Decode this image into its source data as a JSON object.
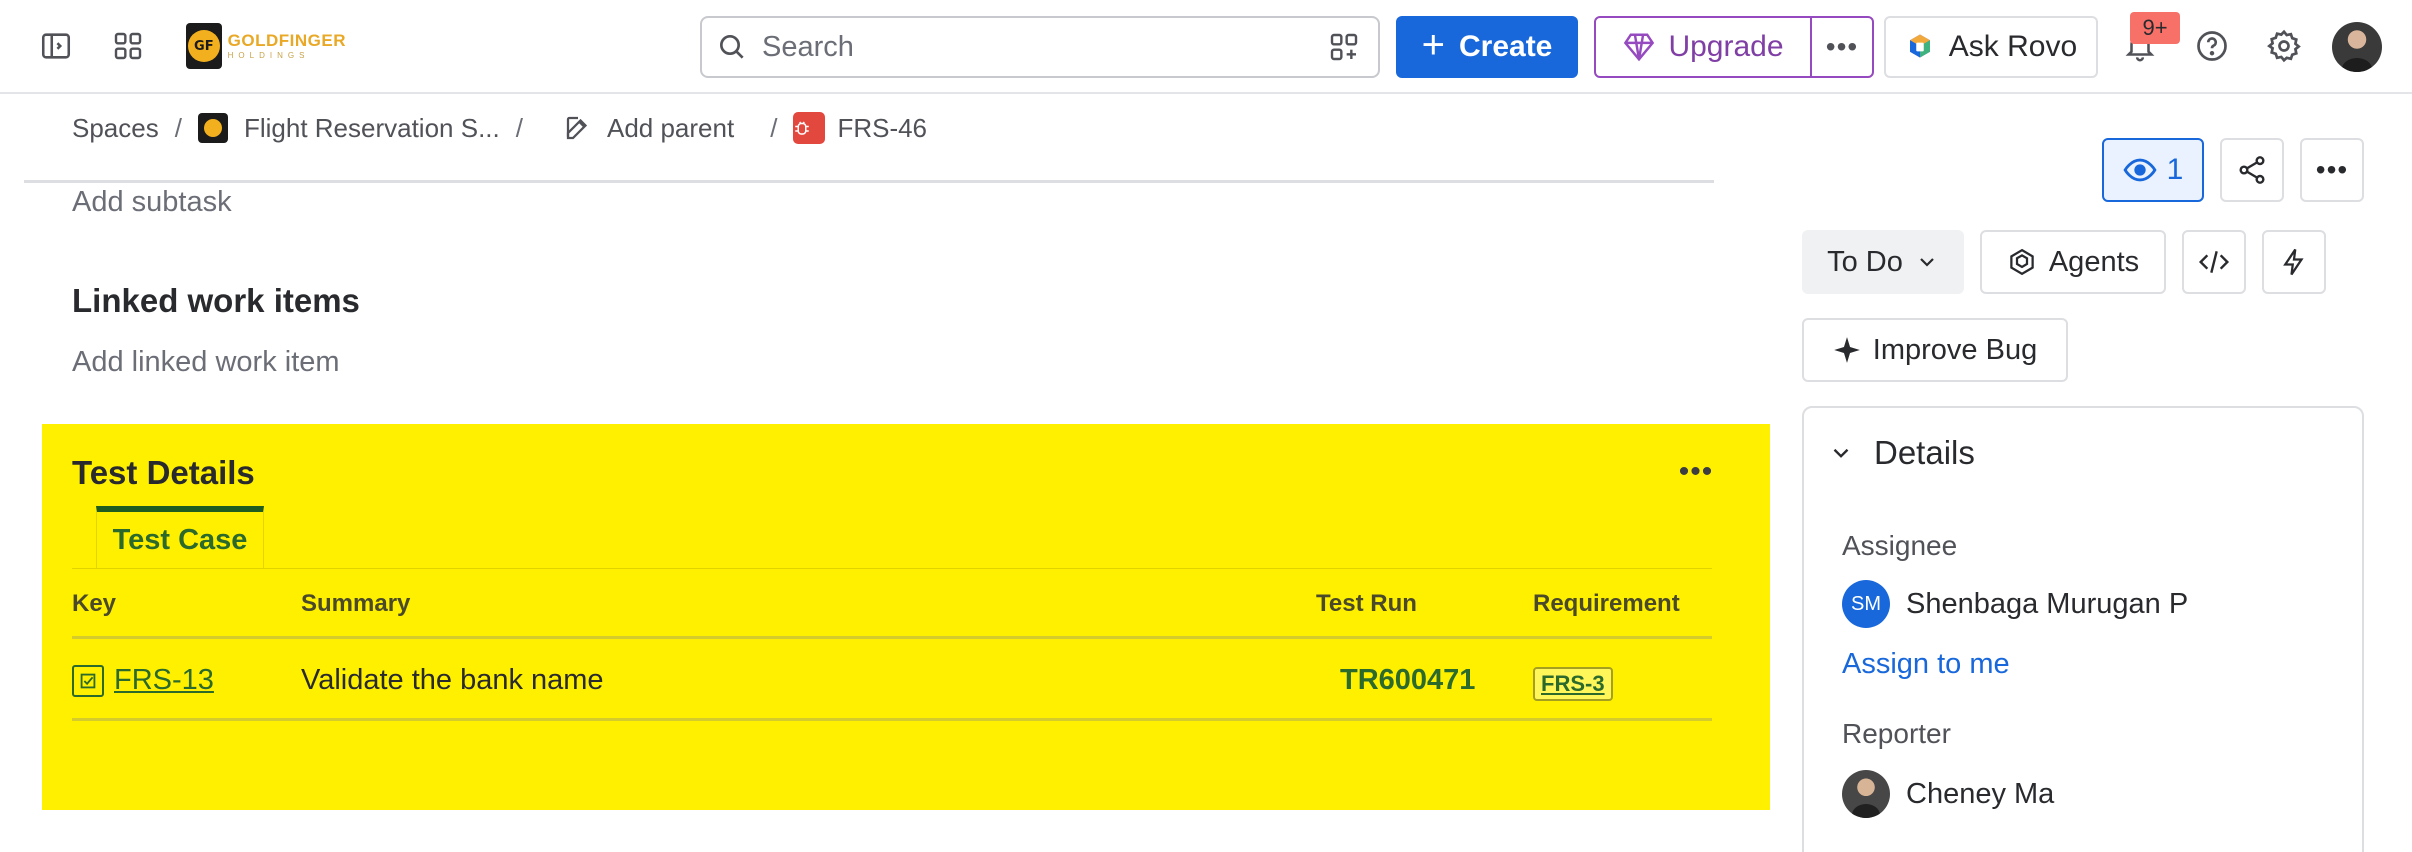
{
  "topnav": {
    "logo_line1": "GOLDFINGER",
    "logo_line2": "HOLDINGS",
    "logo_mark": "GF",
    "search_placeholder": "Search",
    "create_label": "Create",
    "upgrade_label": "Upgrade",
    "more_label": "•••",
    "ask_rovo_label": "Ask Rovo",
    "notification_count": "9+",
    "icons": [
      "sidebar-toggle-icon",
      "app-switcher-icon",
      "search-icon",
      "scan-add-icon",
      "gem-icon",
      "rovo-icon",
      "bell-icon",
      "help-icon",
      "gear-icon"
    ]
  },
  "breadcrumb": {
    "spaces": "Spaces",
    "project": "Flight Reservation S...",
    "add_parent": "Add parent",
    "issue_key": "FRS-46",
    "separator": "/"
  },
  "content": {
    "add_subtask": "Add subtask",
    "linked_title": "Linked work items",
    "add_linked": "Add linked work item"
  },
  "test_details": {
    "title": "Test Details",
    "more_label": "•••",
    "tab_label": "Test Case",
    "columns": [
      "Key",
      "Summary",
      "Test Run",
      "Requirement"
    ],
    "rows": [
      {
        "key": "FRS-13",
        "summary": "Validate the bank name",
        "test_run": "TR600471",
        "requirement": "FRS-3"
      }
    ],
    "panel_color": "#fff000"
  },
  "sidebar": {
    "watch_count": "1",
    "more_label": "•••",
    "status_label": "To Do",
    "agents_label": "Agents",
    "improve_label": "Improve Bug",
    "details_title": "Details",
    "assignee_label": "Assignee",
    "assignee_initials": "SM",
    "assignee_name": "Shenbaga Murugan P",
    "assign_to_me": "Assign to me",
    "reporter_label": "Reporter",
    "reporter_name": "Cheney Ma"
  },
  "colors": {
    "primary": "#1868db",
    "upgrade": "#964ac0",
    "notification": "#f87168",
    "test_green": "#2c6a2c"
  }
}
